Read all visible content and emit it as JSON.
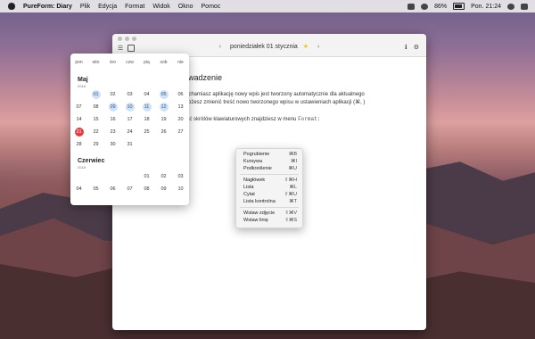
{
  "menubar": {
    "app": "PureForm: Diary",
    "items": [
      "Plik",
      "Edycja",
      "Format",
      "Widok",
      "Okno",
      "Pomoc"
    ],
    "battery": "86%",
    "battery_level": 0.86,
    "clock": "Pon. 21:24"
  },
  "window": {
    "nav_prev": "‹",
    "nav_next": "›",
    "date_title": "poniedziałek 01 stycznia",
    "favorite_icon": "star-icon",
    "info_icon": "info-icon",
    "settings_icon": "sliders-icon"
  },
  "editor": {
    "heading": "owadzenie",
    "line1": "ruchamiasz aplikację nowy wpis jest tworzony automatycznie dla aktualnego",
    "line2": "Możesz zmienić treść nowo tworzonego wpisu w ustawieniach aplikacji (⌘, )",
    "line3_prefix": "ość skrótów klawiaturowych znajdziesz w menu",
    "line3_code": "Format:"
  },
  "calendar": {
    "weekdays": [
      "pon",
      "wto",
      "śro",
      "czw",
      "pią",
      "sob",
      "nie"
    ],
    "may": {
      "name": "Maj",
      "year": "2018",
      "weeks": [
        [
          {
            "d": ""
          },
          {
            "d": "01",
            "m": true
          },
          {
            "d": "02"
          },
          {
            "d": "03"
          },
          {
            "d": "04"
          },
          {
            "d": "05",
            "m": true
          },
          {
            "d": "06"
          }
        ],
        [
          {
            "d": "07"
          },
          {
            "d": "08"
          },
          {
            "d": "09",
            "m": true
          },
          {
            "d": "10",
            "m": true
          },
          {
            "d": "11",
            "m": true
          },
          {
            "d": "12",
            "m": true
          },
          {
            "d": "13"
          }
        ],
        [
          {
            "d": "14"
          },
          {
            "d": "15"
          },
          {
            "d": "16"
          },
          {
            "d": "17"
          },
          {
            "d": "18"
          },
          {
            "d": "19"
          },
          {
            "d": "20"
          }
        ],
        [
          {
            "d": "21",
            "t": true
          },
          {
            "d": "22"
          },
          {
            "d": "23"
          },
          {
            "d": "24"
          },
          {
            "d": "25"
          },
          {
            "d": "26"
          },
          {
            "d": "27"
          }
        ],
        [
          {
            "d": "28"
          },
          {
            "d": "29"
          },
          {
            "d": "30"
          },
          {
            "d": "31"
          },
          {
            "d": ""
          },
          {
            "d": ""
          },
          {
            "d": ""
          }
        ]
      ]
    },
    "june": {
      "name": "Czerwiec",
      "year": "2018",
      "weeks": [
        [
          {
            "d": ""
          },
          {
            "d": ""
          },
          {
            "d": ""
          },
          {
            "d": ""
          },
          {
            "d": "01"
          },
          {
            "d": "02"
          },
          {
            "d": "03"
          }
        ],
        [
          {
            "d": "04"
          },
          {
            "d": "05"
          },
          {
            "d": "06"
          },
          {
            "d": "07"
          },
          {
            "d": "08"
          },
          {
            "d": "09"
          },
          {
            "d": "10"
          }
        ]
      ]
    }
  },
  "format_menu": [
    {
      "label": "Pogrubienie",
      "shortcut": "⌘B"
    },
    {
      "label": "Kursywa",
      "shortcut": "⌘I"
    },
    {
      "label": "Podkreślenie",
      "shortcut": "⌘U"
    },
    {
      "sep": true
    },
    {
      "label": "Nagłówek",
      "shortcut": "⇧⌘H"
    },
    {
      "label": "Lista",
      "shortcut": "⌘L"
    },
    {
      "label": "Cytat",
      "shortcut": "⇧⌘U"
    },
    {
      "label": "Lista kontrolna",
      "shortcut": "⌘T"
    },
    {
      "sep": true
    },
    {
      "label": "Wstaw zdjęcie",
      "shortcut": "⇧⌘V"
    },
    {
      "label": "Wstaw linię",
      "shortcut": "⇧⌘S"
    }
  ]
}
